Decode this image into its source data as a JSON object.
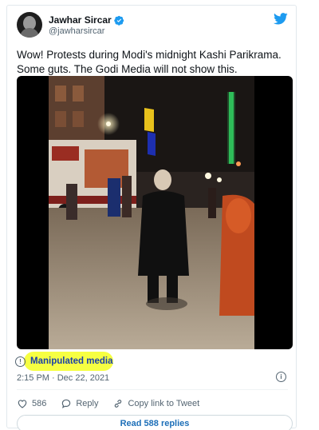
{
  "author": {
    "name": "Jawhar Sircar",
    "handle": "@jawharsircar"
  },
  "tweet": {
    "text": "Wow! Protests during Modi's midnight Kashi Parikrama. Some guts. The Godi Media will not show this.",
    "manipulated_label": "Manipulated media",
    "timestamp": "2:15 PM · Dec 22, 2021"
  },
  "actions": {
    "likes": "586",
    "reply": "Reply",
    "copy_link": "Copy link to Tweet"
  },
  "read_replies": "Read 588 replies",
  "colors": {
    "brand": "#1d9bf0",
    "like": "#536471",
    "highlight": "#f5ff2d"
  },
  "icons": [
    "verified-badge-icon",
    "twitter-bird-icon",
    "info-icon",
    "heart-icon",
    "speech-bubble-icon",
    "link-icon"
  ]
}
